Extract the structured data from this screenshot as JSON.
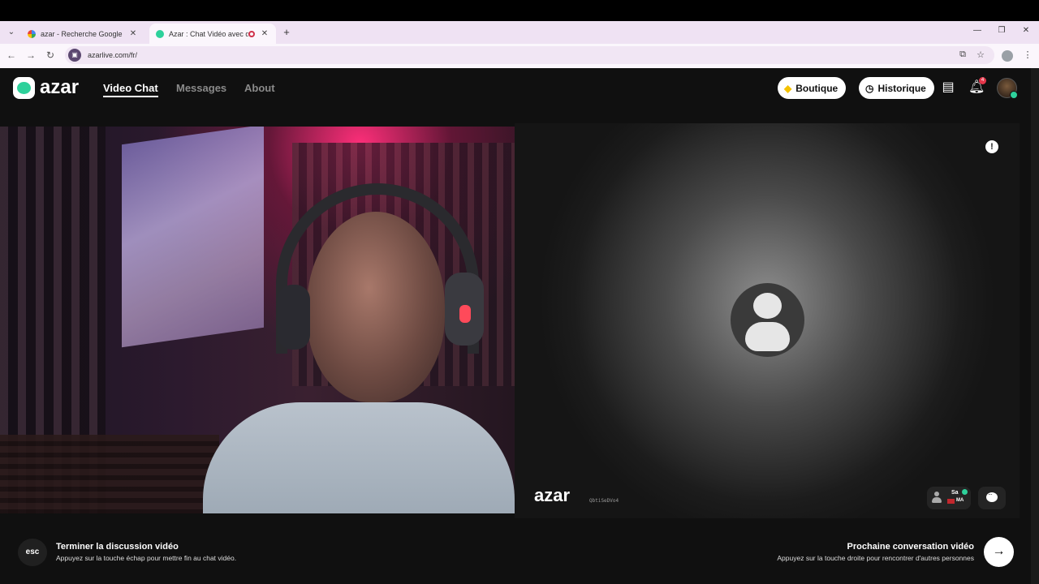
{
  "browser": {
    "tabs": [
      {
        "title": "azar - Recherche Google",
        "close": "✕"
      },
      {
        "title": "Azar : Chat Vidéo avec de n",
        "close": "✕"
      }
    ],
    "new_tab": "+",
    "url": "azarlive.com/fr/"
  },
  "header": {
    "logo": "azar",
    "nav": [
      {
        "label": "Video Chat",
        "active": true
      },
      {
        "label": "Messages",
        "active": false
      },
      {
        "label": "About",
        "active": false
      }
    ],
    "shop_label": "Boutique",
    "history_label": "Historique",
    "notification_count": "4"
  },
  "peer": {
    "watermark_logo": "azar",
    "watermark_id": "QbtiSeDVo4",
    "name": "Sa",
    "country": "MA",
    "report_icon": "!"
  },
  "footer": {
    "esc_key": "esc",
    "end_title": "Terminer la discussion vidéo",
    "end_sub": "Appuyez sur la touche échap pour mettre fin au chat vidéo.",
    "next_title": "Prochaine conversation vidéo",
    "next_sub": "Appuyez sur la touche droite pour rencontrer d'autres personnes",
    "next_arrow": "→"
  },
  "colors": {
    "brand_green": "#2ed19b",
    "background": "#101010",
    "badge_red": "#e5364a"
  },
  "icons": [
    "tab-search-icon",
    "back-icon",
    "forward-icon",
    "reload-icon",
    "install-icon",
    "bookmark-star-icon",
    "menu-kebab-icon",
    "diamond-icon",
    "clock-icon",
    "store-icon",
    "bell-icon",
    "report-icon",
    "user-icon",
    "chat-icon",
    "arrow-right-icon"
  ]
}
